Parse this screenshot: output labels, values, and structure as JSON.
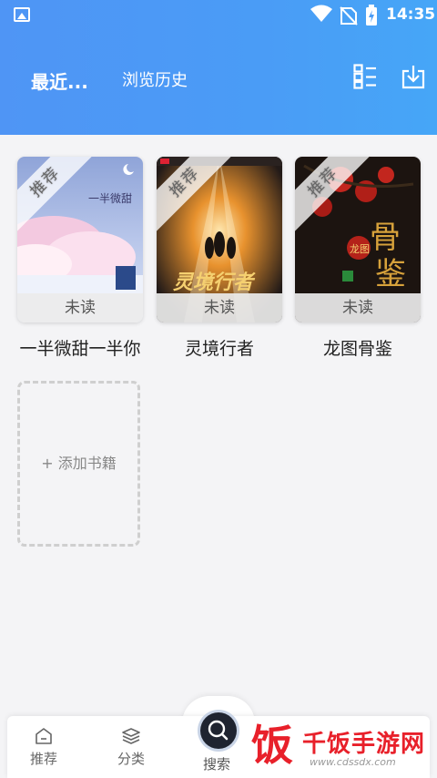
{
  "status": {
    "time": "14:35"
  },
  "header": {
    "tab_recent": "最近...",
    "tab_history": "浏览历史"
  },
  "books": [
    {
      "title": "一半微甜一半你",
      "badge": "推荐",
      "status": "未读"
    },
    {
      "title": "灵境行者",
      "badge": "推荐",
      "status": "未读"
    },
    {
      "title": "龙图骨鉴",
      "badge": "推荐",
      "status": "未读"
    }
  ],
  "add_book": "+ 添加书籍",
  "nav": {
    "recommend": "推荐",
    "category": "分类",
    "search": "搜索"
  },
  "watermark": {
    "logo": "饭",
    "name": "千饭手游网",
    "url": "www.cdssdx.com"
  },
  "colors": {
    "header_blue": "#4a9cf6",
    "watermark_red": "#e8202a"
  }
}
